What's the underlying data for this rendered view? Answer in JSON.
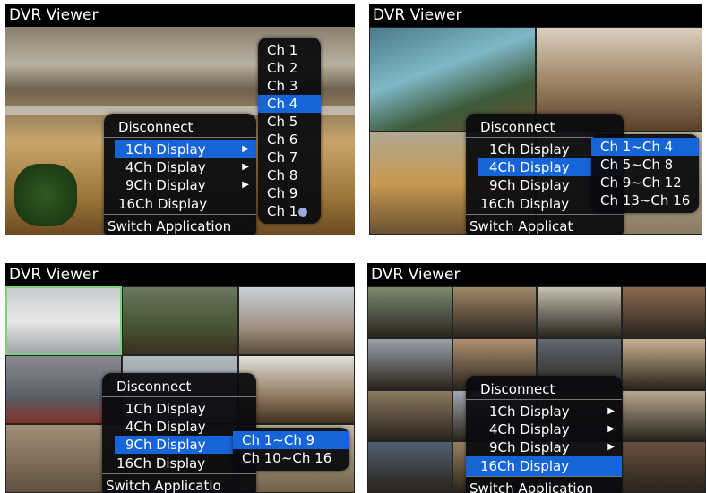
{
  "app_title": "DVR Viewer",
  "colors": {
    "highlight": "#1565d8",
    "menu_bg": "#0a0a0e",
    "selected_tile_border": "#7bd07b"
  },
  "main_menu": {
    "disconnect": "Disconnect",
    "ch1": "1Ch Display",
    "ch4": "4Ch Display",
    "ch9": "9Ch Display",
    "ch16": "16Ch Display",
    "switch_app": "Switch Application",
    "switch_app_truncated": "Switch Applicat",
    "switch_app_truncated2": "Switch Applicatio"
  },
  "panel1_submenu": [
    "Ch 1",
    "Ch 2",
    "Ch 3",
    "Ch 4",
    "Ch 5",
    "Ch 6",
    "Ch 7",
    "Ch 8",
    "Ch 9",
    "Ch 1"
  ],
  "panel2_submenu": [
    "Ch 1~Ch 4",
    "Ch 5~Ch 8",
    "Ch 9~Ch 12",
    "Ch 13~Ch 16"
  ],
  "panel3_submenu": [
    "Ch 1~Ch 9",
    "Ch 10~Ch 16"
  ]
}
